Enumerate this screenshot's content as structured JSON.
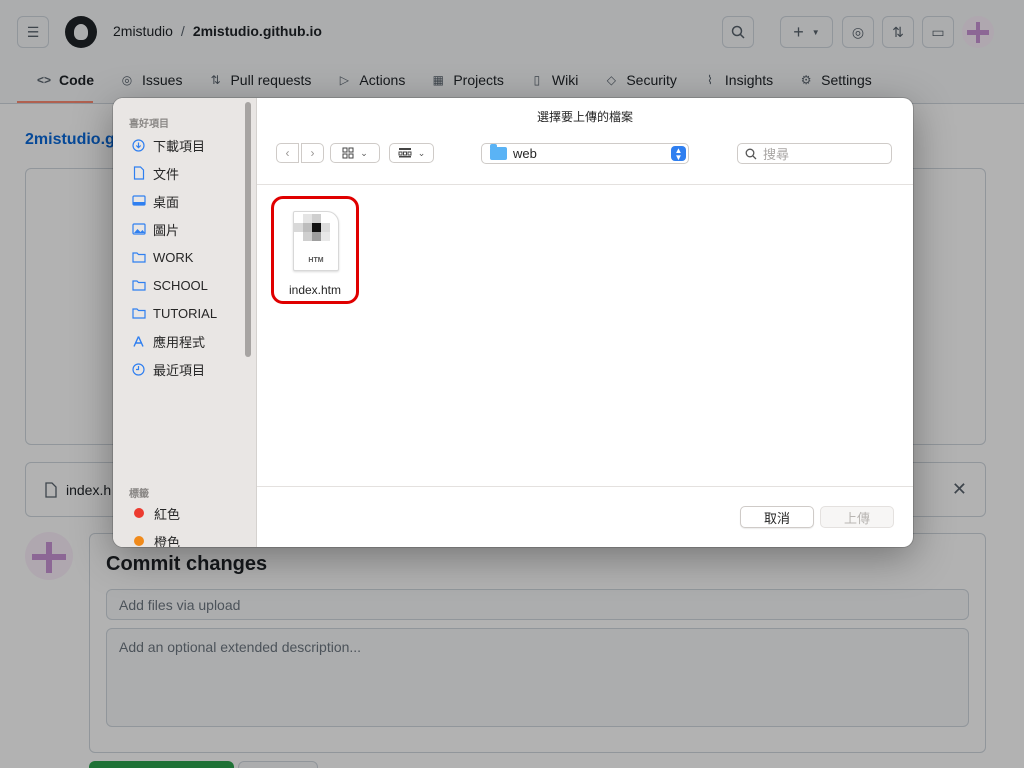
{
  "github": {
    "owner": "2mistudio",
    "separator": "/",
    "repo": "2mistudio.github.io",
    "plus_label": "+",
    "nav": [
      {
        "label": "Code",
        "icon": "code-icon",
        "glyph": "<>"
      },
      {
        "label": "Issues",
        "icon": "issue-icon",
        "glyph": "◎"
      },
      {
        "label": "Pull requests",
        "icon": "pull-request-icon",
        "glyph": "⇅"
      },
      {
        "label": "Actions",
        "icon": "play-icon",
        "glyph": "▷"
      },
      {
        "label": "Projects",
        "icon": "table-icon",
        "glyph": "▦"
      },
      {
        "label": "Wiki",
        "icon": "book-icon",
        "glyph": "▯"
      },
      {
        "label": "Security",
        "icon": "shield-icon",
        "glyph": "◇"
      },
      {
        "label": "Insights",
        "icon": "graph-icon",
        "glyph": "⌇"
      },
      {
        "label": "Settings",
        "icon": "gear-icon",
        "glyph": "⚙"
      }
    ],
    "path_label": "2mistudio.g",
    "file_bar_name": "index.h",
    "commit": {
      "title": "Commit changes",
      "summary_placeholder": "Add files via upload",
      "description_placeholder": "Add an optional extended description..."
    }
  },
  "dialog": {
    "title": "選擇要上傳的檔案",
    "favorites_header": "喜好項目",
    "favorites": [
      {
        "label": "下載項目",
        "icon": "download-icon",
        "glyph": "⊕"
      },
      {
        "label": "文件",
        "icon": "document-icon",
        "glyph": "▯"
      },
      {
        "label": "桌面",
        "icon": "desktop-icon",
        "glyph": "▭"
      },
      {
        "label": "圖片",
        "icon": "photo-icon",
        "glyph": "▣"
      },
      {
        "label": "WORK",
        "icon": "folder-icon",
        "glyph": "▱"
      },
      {
        "label": "SCHOOL",
        "icon": "folder-icon",
        "glyph": "▱"
      },
      {
        "label": "TUTORIAL",
        "icon": "folder-icon",
        "glyph": "▱"
      },
      {
        "label": "應用程式",
        "icon": "applications-icon",
        "glyph": "A"
      },
      {
        "label": "最近項目",
        "icon": "clock-icon",
        "glyph": "◷"
      }
    ],
    "tags_header": "標籤",
    "tags": [
      {
        "label": "紅色",
        "color": "#ec3b2f"
      },
      {
        "label": "橙色",
        "color": "#f08a1b"
      }
    ],
    "location": "web",
    "search_placeholder": "搜尋",
    "file": {
      "name": "index.htm",
      "ext": "HTM"
    },
    "cancel_label": "取消",
    "upload_label": "上傳"
  }
}
